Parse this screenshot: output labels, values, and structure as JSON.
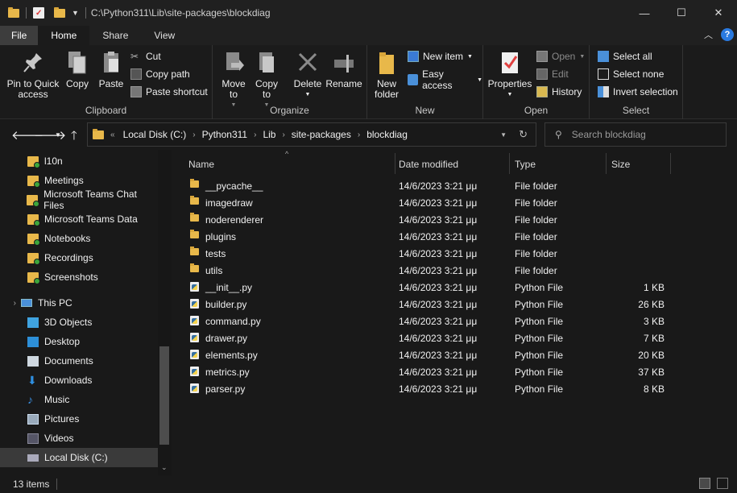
{
  "titlebar": {
    "path": "C:\\Python311\\Lib\\site-packages\\blockdiag",
    "minimize": "—",
    "maximize": "☐",
    "close": "✕"
  },
  "tabs": [
    "File",
    "Home",
    "Share",
    "View"
  ],
  "help": "?",
  "ribbon": {
    "clipboard": {
      "label": "Clipboard",
      "pin_to_quick_access": "Pin to Quick access",
      "copy": "Copy",
      "paste": "Paste",
      "cut": "Cut",
      "copy_path": "Copy path",
      "paste_shortcut": "Paste shortcut"
    },
    "organize": {
      "label": "Organize",
      "move_to": "Move to",
      "copy_to": "Copy to",
      "delete": "Delete",
      "rename": "Rename"
    },
    "new": {
      "label": "New",
      "new_folder": "New folder",
      "new_item": "New item",
      "easy_access": "Easy access"
    },
    "open": {
      "label": "Open",
      "properties": "Properties",
      "open": "Open",
      "edit": "Edit",
      "history": "History"
    },
    "select": {
      "label": "Select",
      "select_all": "Select all",
      "select_none": "Select none",
      "invert_selection": "Invert selection"
    }
  },
  "address": {
    "crumbs": [
      "Local Disk (C:)",
      "Python311",
      "Lib",
      "site-packages",
      "blockdiag"
    ],
    "search_placeholder": "Search blockdiag"
  },
  "nav": {
    "quick_access": [
      "l10n",
      "Meetings",
      "Microsoft Teams Chat Files",
      "Microsoft Teams Data",
      "Notebooks",
      "Recordings",
      "Screenshots"
    ],
    "this_pc": "This PC",
    "pc_items": [
      "3D Objects",
      "Desktop",
      "Documents",
      "Downloads",
      "Music",
      "Pictures",
      "Videos",
      "Local Disk (C:)"
    ]
  },
  "columns": {
    "name": "Name",
    "date": "Date modified",
    "type": "Type",
    "size": "Size"
  },
  "files": [
    {
      "name": "__pycache__",
      "date": "14/6/2023 3:21 μμ",
      "type": "File folder",
      "size": "",
      "kind": "folder"
    },
    {
      "name": "imagedraw",
      "date": "14/6/2023 3:21 μμ",
      "type": "File folder",
      "size": "",
      "kind": "folder"
    },
    {
      "name": "noderenderer",
      "date": "14/6/2023 3:21 μμ",
      "type": "File folder",
      "size": "",
      "kind": "folder"
    },
    {
      "name": "plugins",
      "date": "14/6/2023 3:21 μμ",
      "type": "File folder",
      "size": "",
      "kind": "folder"
    },
    {
      "name": "tests",
      "date": "14/6/2023 3:21 μμ",
      "type": "File folder",
      "size": "",
      "kind": "folder"
    },
    {
      "name": "utils",
      "date": "14/6/2023 3:21 μμ",
      "type": "File folder",
      "size": "",
      "kind": "folder"
    },
    {
      "name": "__init__.py",
      "date": "14/6/2023 3:21 μμ",
      "type": "Python File",
      "size": "1 KB",
      "kind": "py"
    },
    {
      "name": "builder.py",
      "date": "14/6/2023 3:21 μμ",
      "type": "Python File",
      "size": "26 KB",
      "kind": "py"
    },
    {
      "name": "command.py",
      "date": "14/6/2023 3:21 μμ",
      "type": "Python File",
      "size": "3 KB",
      "kind": "py"
    },
    {
      "name": "drawer.py",
      "date": "14/6/2023 3:21 μμ",
      "type": "Python File",
      "size": "7 KB",
      "kind": "py"
    },
    {
      "name": "elements.py",
      "date": "14/6/2023 3:21 μμ",
      "type": "Python File",
      "size": "20 KB",
      "kind": "py"
    },
    {
      "name": "metrics.py",
      "date": "14/6/2023 3:21 μμ",
      "type": "Python File",
      "size": "37 KB",
      "kind": "py"
    },
    {
      "name": "parser.py",
      "date": "14/6/2023 3:21 μμ",
      "type": "Python File",
      "size": "8 KB",
      "kind": "py"
    }
  ],
  "status": {
    "count": "13 items"
  }
}
